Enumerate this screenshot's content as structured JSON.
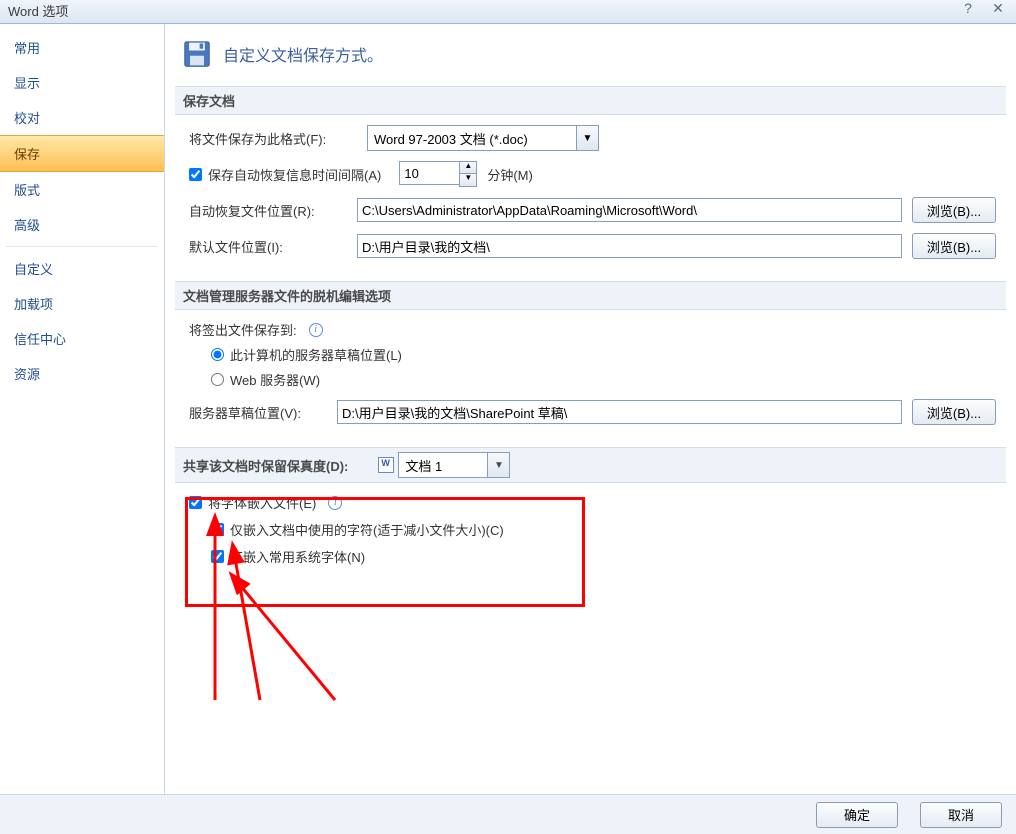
{
  "window_title": "Word 选项",
  "sidebar": {
    "items": [
      {
        "label": "常用"
      },
      {
        "label": "显示"
      },
      {
        "label": "校对"
      },
      {
        "label": "保存",
        "selected": true
      },
      {
        "label": "版式"
      },
      {
        "label": "高级"
      },
      {
        "label": "自定义"
      },
      {
        "label": "加载项"
      },
      {
        "label": "信任中心"
      },
      {
        "label": "资源"
      }
    ]
  },
  "header": {
    "title": "自定义文档保存方式。"
  },
  "section_save": {
    "head": "保存文档",
    "format_label": "将文件保存为此格式(F):",
    "format_value": "Word 97-2003 文档 (*.doc)",
    "autorecover_check": "保存自动恢复信息时间间隔(A)",
    "autorecover_value": "10",
    "autorecover_unit": "分钟(M)",
    "autorecover_loc_label": "自动恢复文件位置(R):",
    "autorecover_loc_value": "C:\\Users\\Administrator\\AppData\\Roaming\\Microsoft\\Word\\",
    "default_loc_label": "默认文件位置(I):",
    "default_loc_value": "D:\\用户目录\\我的文档\\",
    "browse": "浏览(B)..."
  },
  "section_offline": {
    "head": "文档管理服务器文件的脱机编辑选项",
    "checkout_label": "将签出文件保存到:",
    "radio_local": "此计算机的服务器草稿位置(L)",
    "radio_web": "Web 服务器(W)",
    "draft_loc_label": "服务器草稿位置(V):",
    "draft_loc_value": "D:\\用户目录\\我的文档\\SharePoint 草稿\\",
    "browse": "浏览(B)..."
  },
  "section_fidelity": {
    "head": "共享该文档时保留保真度(D):",
    "doc_value": "文档 1",
    "embed_fonts": "将字体嵌入文件(E)",
    "embed_used": "仅嵌入文档中使用的字符(适于减小文件大小)(C)",
    "embed_noskip": "不嵌入常用系统字体(N)"
  },
  "buttons": {
    "ok": "确定",
    "cancel": "取消"
  }
}
